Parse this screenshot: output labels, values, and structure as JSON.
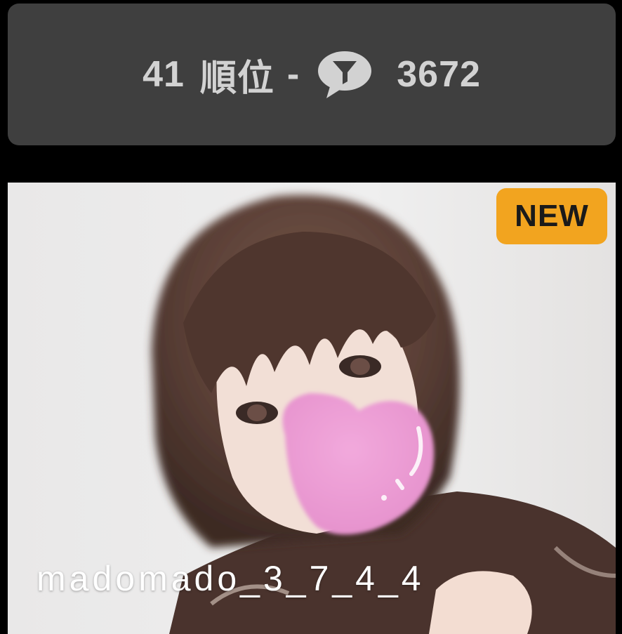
{
  "ranking": {
    "rank": "41",
    "rank_suffix": "順位",
    "separator": "-",
    "comment_icon": "speech-bubble-icon",
    "comment_count": "3672"
  },
  "card": {
    "badge_label": "NEW",
    "username": "madomado_3_7_4_4"
  },
  "colors": {
    "bar_background": "#3f3f3f",
    "bar_text": "#d2d2d2",
    "badge_background": "#f2a41f",
    "badge_text": "#1a1a1a",
    "username_text": "#ffffff",
    "page_background": "#000000"
  }
}
